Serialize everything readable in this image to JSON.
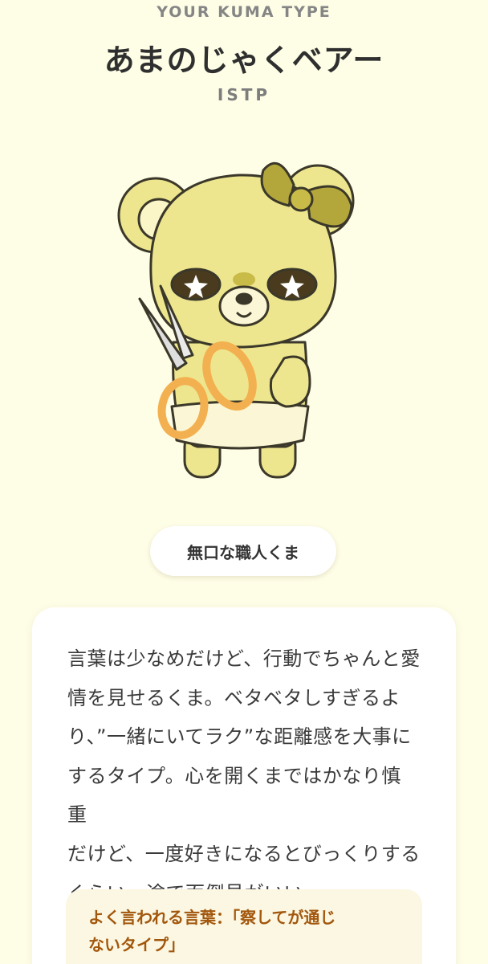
{
  "header": {
    "eyebrow": "YOUR KUMA TYPE",
    "title": "あまのじゃくベアー",
    "type_code": "ISTP"
  },
  "illustration": {
    "subject": "yellow bear with bow, star eyes, holding scissors"
  },
  "nickname": {
    "label": "無口な職人くま"
  },
  "description": {
    "lines": [
      "言葉は少なめだけど、行動でちゃんと愛",
      "情を見せるくま。ベタベタしすぎるよ",
      "り、”一緒にいてラク”な距離感を大事に",
      "するタイプ。心を開くまではかなり慎重",
      "だけど、一度好きになるとびっくりする",
      "くらい一途で面倒見がいい。"
    ]
  },
  "quote": {
    "lines": [
      "よく言われる言葉：「察してが通じ",
      "ないタイプ」"
    ]
  },
  "colors": {
    "background": "#fefde6",
    "bear_fur": "#ede68e",
    "bow": "#b3a73c",
    "scissors": "#f3b050",
    "quote_text": "#a2570d"
  }
}
